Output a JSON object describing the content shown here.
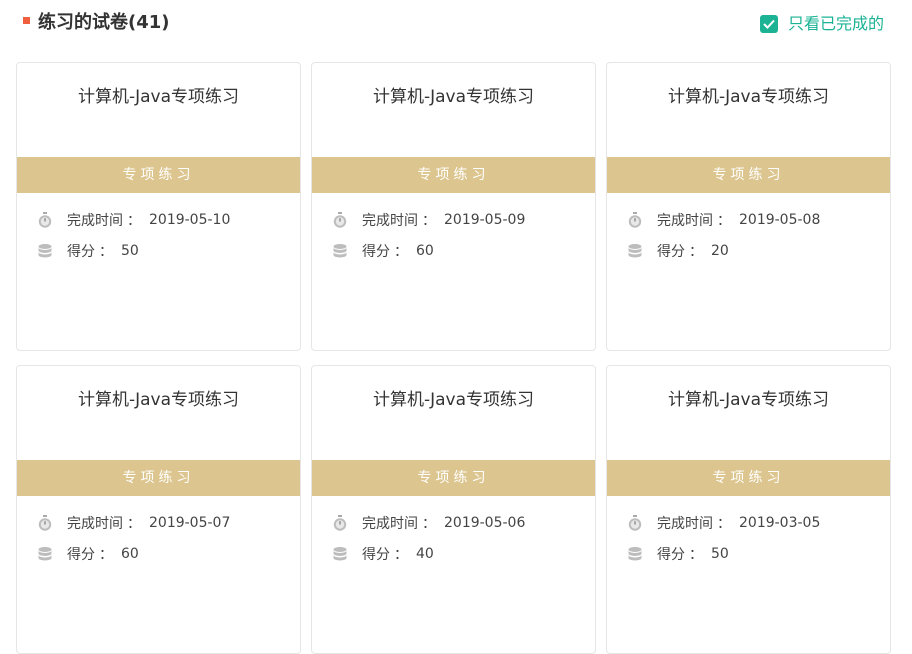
{
  "header": {
    "title": "练习的试卷(41)",
    "filter_label": "只看已完成的",
    "filter_checked": true,
    "accent_color": "#1bb394",
    "mark_color": "#f0603f"
  },
  "labels": {
    "time_label": "完成时间",
    "score_label": "得分",
    "colon": "："
  },
  "cards": [
    {
      "title": "计算机-Java专项练习",
      "tag": "专项练习",
      "date": "2019-05-10",
      "score": "50"
    },
    {
      "title": "计算机-Java专项练习",
      "tag": "专项练习",
      "date": "2019-05-09",
      "score": "60"
    },
    {
      "title": "计算机-Java专项练习",
      "tag": "专项练习",
      "date": "2019-05-08",
      "score": "20"
    },
    {
      "title": "计算机-Java专项练习",
      "tag": "专项练习",
      "date": "2019-05-07",
      "score": "60"
    },
    {
      "title": "计算机-Java专项练习",
      "tag": "专项练习",
      "date": "2019-05-06",
      "score": "40"
    },
    {
      "title": "计算机-Java专项练习",
      "tag": "专项练习",
      "date": "2019-03-05",
      "score": "50"
    }
  ],
  "icons": {
    "time": "stopwatch-icon",
    "score": "database-icon",
    "filter": "checkbox-check-icon"
  },
  "colors": {
    "band": "#dcc58e"
  }
}
